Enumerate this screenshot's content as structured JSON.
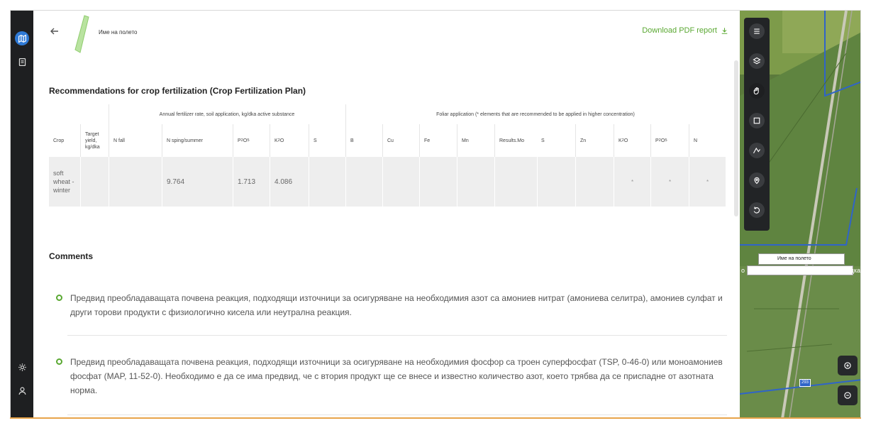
{
  "header": {
    "field_name": "Име на полето",
    "download_label": "Download PDF report"
  },
  "report": {
    "title": "Recommendations for crop fertilization (Crop Fertilization Plan)",
    "group_soil": "Annual fertilizer rate, soil application, kg/dka active substance",
    "group_foliar": "Foliar application (* elements that are recommended to be applied in higher concentration)",
    "columns": {
      "crop": "Crop",
      "target_yield": "Target yield, kg/dka",
      "n_fall": "N fall",
      "n_spring": "N sping/summer",
      "p2o5": "P",
      "k2o": "K",
      "s": "S",
      "b": "B",
      "cu": "Cu",
      "fe": "Fe",
      "mn": "Mn",
      "results_mo": "Results.Mo",
      "s2": "S",
      "zn": "Zn",
      "k2o_f": "K",
      "p2o5_f": "P",
      "n": "N"
    },
    "row": {
      "crop": "soft wheat - winter",
      "n_spring": "9.764",
      "p2o5": "1.713",
      "k2o": "4.086",
      "k2o_f": "*",
      "p2o5_f": "*",
      "n": "*"
    }
  },
  "comments": {
    "title": "Comments",
    "items": [
      "Предвид преобладаващата почвена реакция, подходящи източници за осигуряване на необходимия азот са амониев нитрат (амониева селитра), амониев сулфат и други торови продукти с физиологично кисела или неутрална реакция.",
      "Предвид преобладаващата почвена реакция, подходящи източници за осигуряване на необходимия фосфор са троен суперфосфат (TSP, 0-46-0) или моноамониев фосфат (MAP, 11-52-0). Необходимо е да се има предвид, че с втория продукт ще се внесе и известно количество азот, което трябва да се приспадне от азотната норма."
    ]
  },
  "map": {
    "field_label": "Име на полето",
    "side_left": "о",
    "side_right": "э дка",
    "road_number": "293"
  },
  "colors": {
    "accent_green": "#5aa832",
    "rail_active": "#2f7ad6",
    "rail_bg": "#1e1f21"
  },
  "icons": [
    "map-icon",
    "document-icon",
    "settings-icon",
    "user-icon",
    "arrow-left-icon",
    "download-icon",
    "list-icon",
    "layers-icon",
    "hand-icon",
    "polygon-icon",
    "line-icon",
    "pin-icon",
    "undo-icon",
    "zoom-in-icon",
    "zoom-out-icon"
  ]
}
